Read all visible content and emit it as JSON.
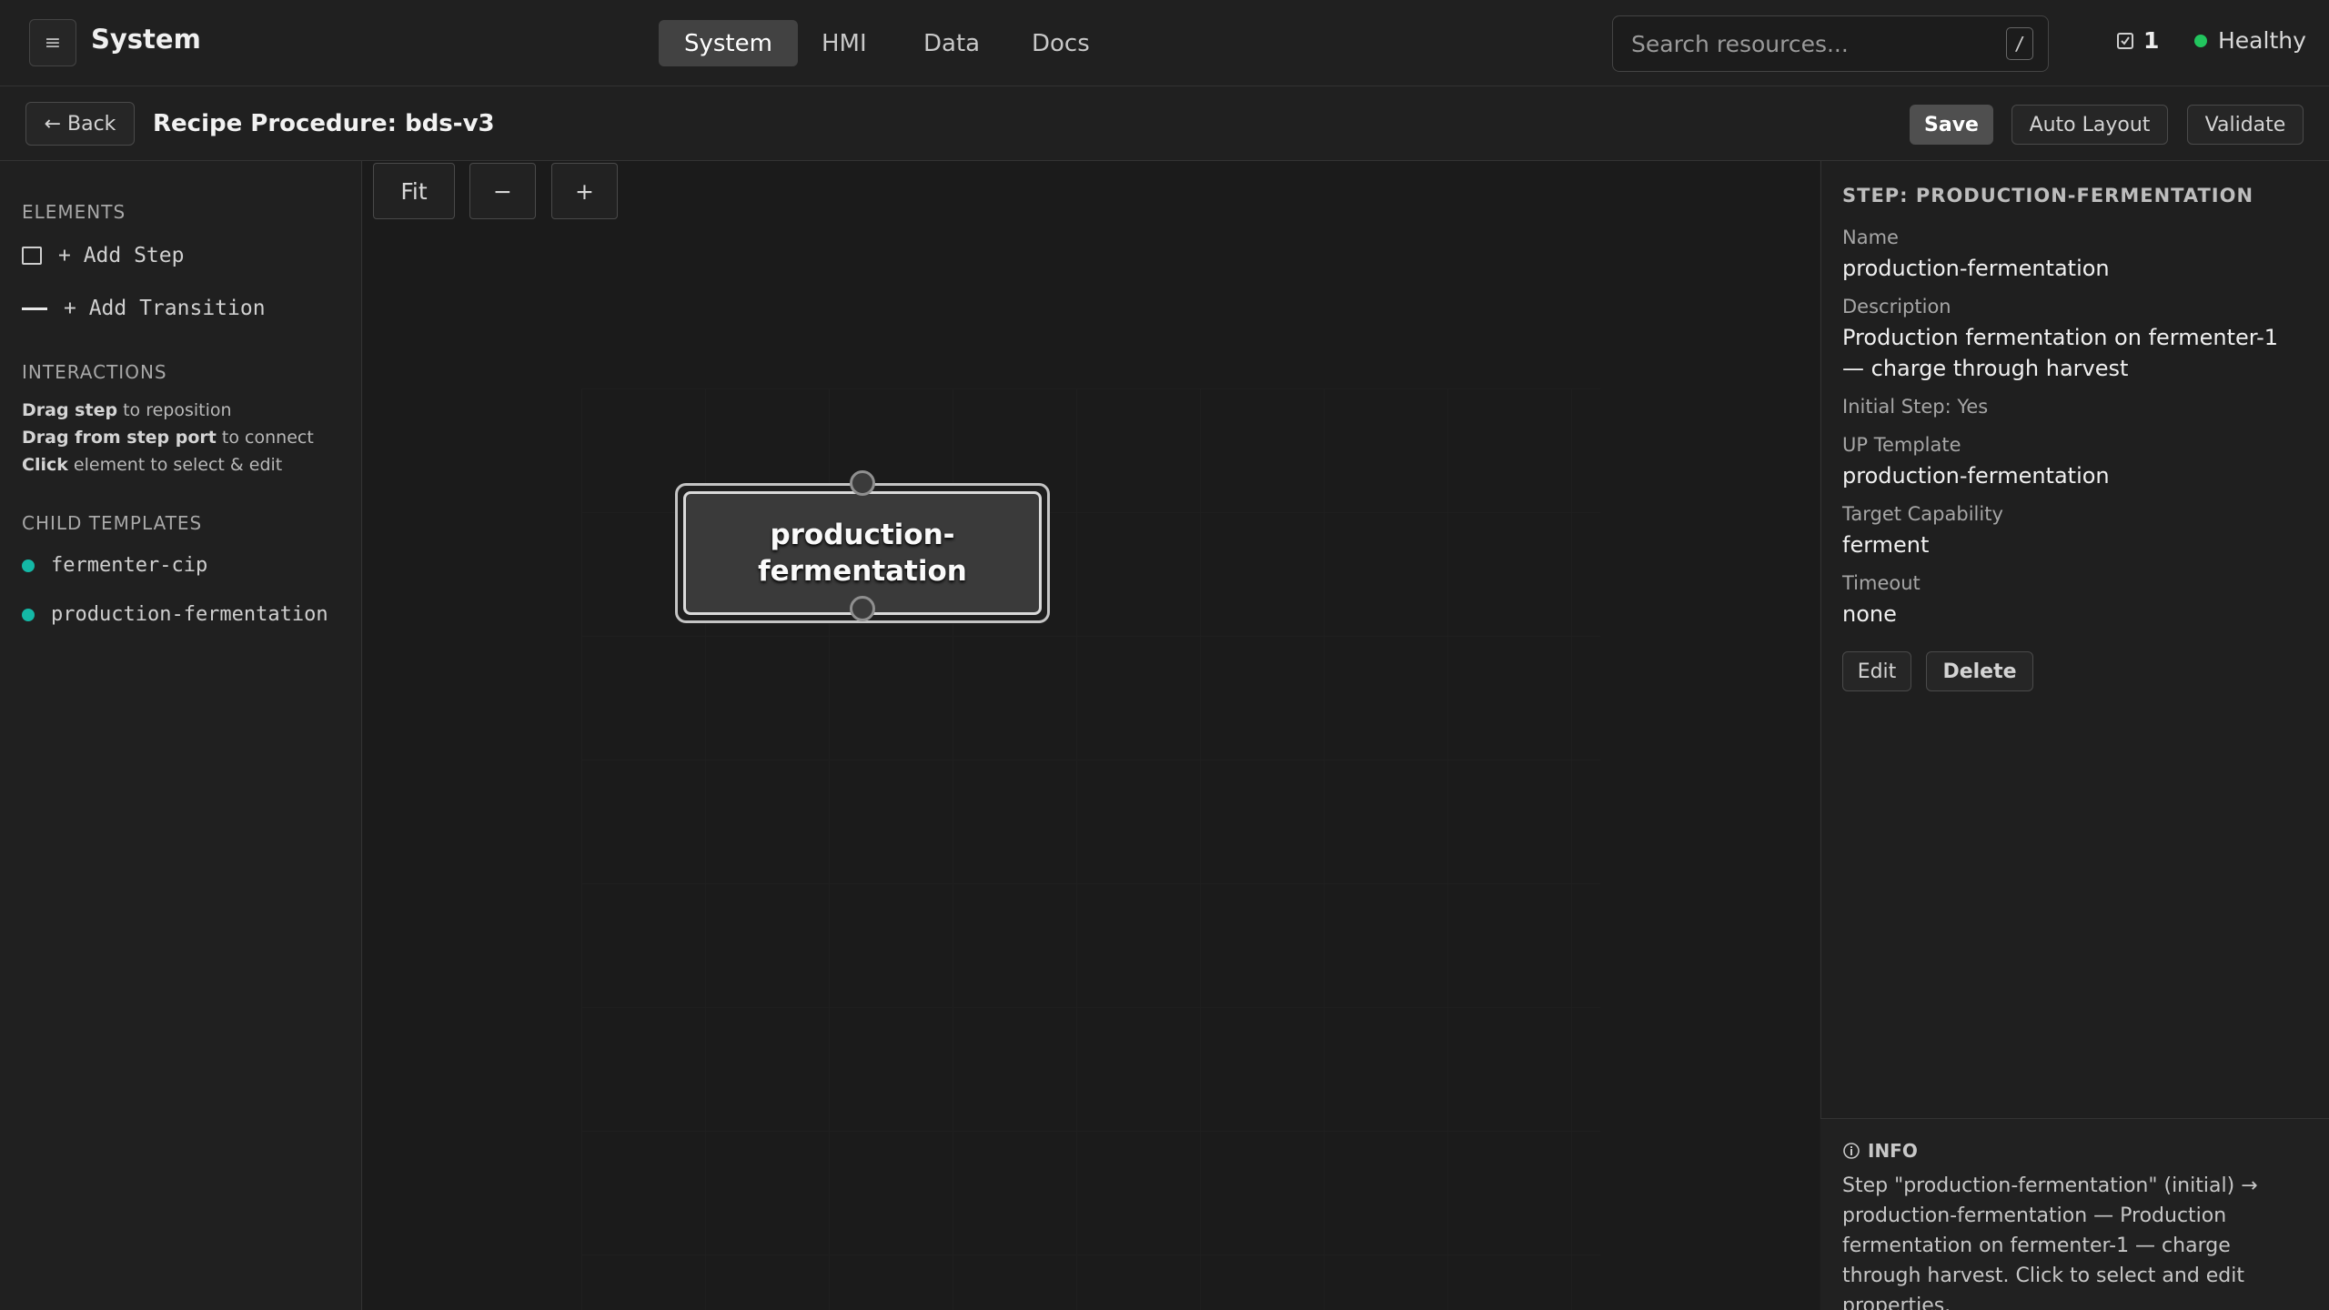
{
  "header": {
    "menu_icon": "hamburger-icon",
    "app_title": "System",
    "tabs": [
      {
        "label": "System",
        "active": true
      },
      {
        "label": "HMI",
        "active": false
      },
      {
        "label": "Data",
        "active": false
      },
      {
        "label": "Docs",
        "active": false
      }
    ],
    "search": {
      "placeholder": "Search resources...",
      "shortcut": "/"
    },
    "tasks": {
      "icon": "checkbox-icon",
      "count": "1"
    },
    "status": {
      "label": "Healthy",
      "color": "#22c55e"
    }
  },
  "subheader": {
    "back_label": "← Back",
    "page_title": "Recipe Procedure: bds-v3",
    "save_label": "Save",
    "auto_layout_label": "Auto Layout",
    "validate_label": "Validate"
  },
  "sidebar": {
    "elements_heading": "ELEMENTS",
    "add_step": "+ Add Step",
    "add_transition": "+ Add Transition",
    "interactions_heading": "INTERACTIONS",
    "hints": [
      {
        "bold": "Drag step",
        "rest": " to reposition"
      },
      {
        "bold": "Drag from step port",
        "rest": " to connect"
      },
      {
        "bold": "Click",
        "rest": " element to select & edit"
      }
    ],
    "child_heading": "CHILD TEMPLATES",
    "children": [
      {
        "name": "fermenter-cip",
        "color": "#14b8a6"
      },
      {
        "name": "production-fermentation",
        "color": "#14b8a6"
      }
    ]
  },
  "canvas": {
    "fit_label": "Fit",
    "zoom_out_label": "−",
    "zoom_in_label": "+",
    "step": {
      "line1": "production-",
      "line2": "fermentation"
    }
  },
  "properties": {
    "title": "STEP: PRODUCTION-FERMENTATION",
    "name_label": "Name",
    "name_value": "production-fermentation",
    "description_label": "Description",
    "description_value": "Production fermentation on fermenter-1 — charge through harvest",
    "initial_step": "Initial Step: Yes",
    "up_template_label": "UP Template",
    "up_template_value": "production-fermentation",
    "capability_label": "Target Capability",
    "capability_value": "ferment",
    "timeout_label": "Timeout",
    "timeout_value": "none",
    "edit_label": "Edit",
    "delete_label": "Delete"
  },
  "info": {
    "icon": "info-icon",
    "heading": "INFO",
    "text": "Step \"production-fermentation\" (initial) → production-fermentation — Production fermentation on fermenter-1 — charge through harvest. Click to select and edit properties."
  }
}
